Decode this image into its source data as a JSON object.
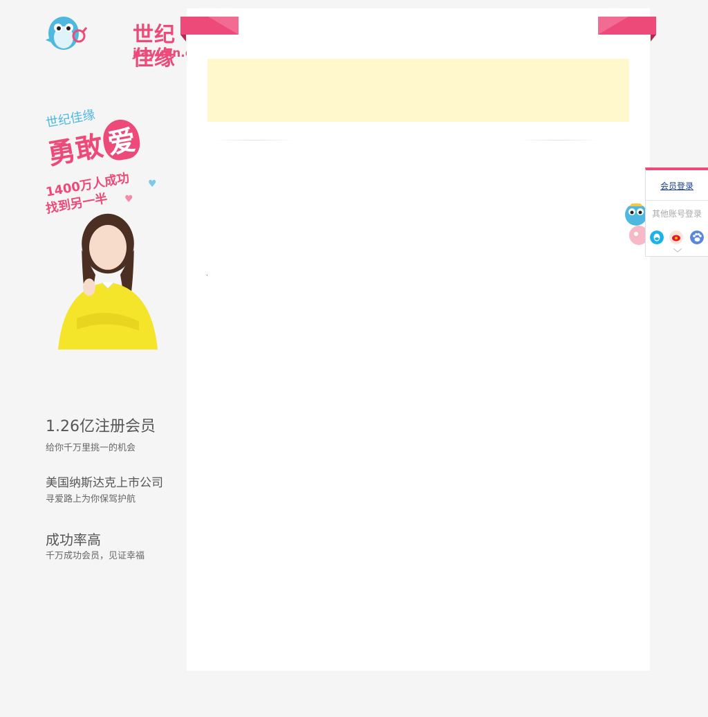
{
  "logo": {
    "name_cn": "世纪佳缘",
    "domain": "jiayuan.com",
    "mascot": "penguin-mascot-icon"
  },
  "promo": {
    "brand": "世纪佳缘",
    "slogan_a": "勇敢",
    "slogan_b": "爱",
    "line1": "1400万人成功",
    "line2": "找到另一半"
  },
  "features": [
    {
      "title": "1.26亿注册会员",
      "desc": "给你千万里挑一的机会"
    },
    {
      "title": "美国纳斯达克上市公司",
      "desc": "寻爱路上为你保驾护航"
    },
    {
      "title": "成功率高",
      "desc": "千万成功会员，见证幸福"
    }
  ],
  "login_panel": {
    "member_login": "会员登录",
    "other_accounts": "其他账号登录",
    "icons": [
      "qq-icon",
      "weibo-icon",
      "baidu-icon"
    ]
  },
  "colors": {
    "brand_pink": "#ee4a79",
    "notice_bg": "#fef8cc",
    "page_bg": "#f5f5f5",
    "link_blue": "#1a3f8b"
  }
}
